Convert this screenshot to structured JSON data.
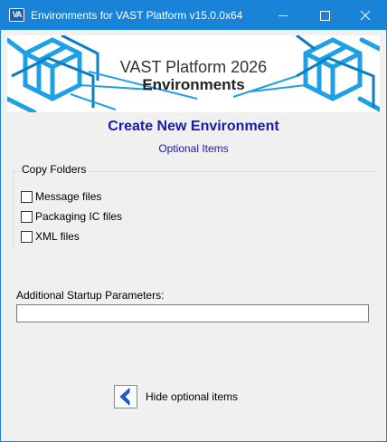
{
  "window": {
    "title": "Environments for VAST Platform v15.0.0x64",
    "icon": "vast-app-icon",
    "icon_text": "VA"
  },
  "banner": {
    "title": "VAST Platform 2026",
    "subtitle": "Environments"
  },
  "page": {
    "heading": "Create New Environment",
    "subheading": "Optional Items"
  },
  "copy_folders": {
    "legend": "Copy Folders",
    "items": [
      {
        "label": "Message files",
        "checked": false
      },
      {
        "label": "Packaging IC files",
        "checked": false
      },
      {
        "label": "XML files",
        "checked": false
      }
    ]
  },
  "startup": {
    "label": "Additional Startup Parameters:",
    "value": ""
  },
  "hide_optional": {
    "label": "Hide optional items",
    "icon": "chevron-left-icon"
  },
  "colors": {
    "titlebar": "#1883d7",
    "heading": "#1a1aa8",
    "banner_accent": "#1ea0e6"
  }
}
